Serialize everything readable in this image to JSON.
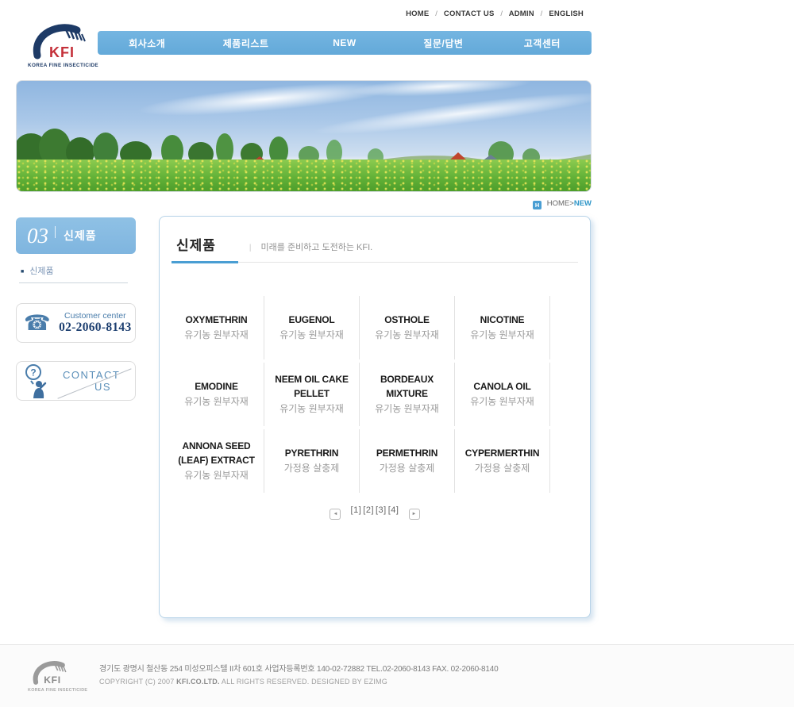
{
  "util_nav": {
    "items": [
      "HOME",
      "CONTACT US",
      "ADMIN",
      "ENGLISH"
    ],
    "separator": "/"
  },
  "logo": {
    "text": "KFI",
    "caption": "KOREA FINE INSECTICIDE"
  },
  "nav": {
    "items": [
      "회사소개",
      "제품리스트",
      "NEW",
      "질문/답변",
      "고객센터"
    ]
  },
  "breadcrumb": {
    "home_icon": "H",
    "home": "HOME",
    "separator": ">",
    "current": "NEW"
  },
  "sidebar": {
    "section_number": "03",
    "section_title": "신제품",
    "menu_bullet": "■",
    "menu_item": "신제품",
    "customer_center": {
      "phone_icon": "☎",
      "label": "Customer center",
      "phone": "02-2060-8143"
    },
    "contact": {
      "line1": "CONTACT",
      "line2": "US"
    }
  },
  "main": {
    "title": "신제품",
    "subtitle_separator": "|",
    "subtitle": "미래를 준비하고 도전하는 KFI.",
    "products": [
      {
        "name": "OXYMETHRIN",
        "category": "유기농 원부자재"
      },
      {
        "name": "EUGENOL",
        "category": "유기농 원부자재"
      },
      {
        "name": "OSTHOLE",
        "category": "유기농 원부자재"
      },
      {
        "name": "NICOTINE",
        "category": "유기농 원부자재"
      },
      {
        "name": "EMODINE",
        "category": "유기농 원부자재"
      },
      {
        "name": "NEEM OIL CAKE PELLET",
        "category": "유기농 원부자재"
      },
      {
        "name": "BORDEAUX MIXTURE",
        "category": "유기농 원부자재"
      },
      {
        "name": "CANOLA OIL",
        "category": "유기농 원부자재"
      },
      {
        "name": "ANNONA SEED (LEAF) EXTRACT",
        "category": "유기농 원부자재"
      },
      {
        "name": "PYRETHRIN",
        "category": "가정용 살충제"
      },
      {
        "name": "PERMETHRIN",
        "category": "가정용 살충제"
      },
      {
        "name": "CYPERMERTHIN",
        "category": "가정용 살충제"
      }
    ],
    "pagination": {
      "prev_icon": "◄",
      "next_icon": "►",
      "pages": [
        "[1]",
        "[2]",
        "[3]",
        "[4]"
      ]
    }
  },
  "footer": {
    "logo_text": "KFI",
    "logo_caption": "KOREA FINE INSECTICIDE",
    "address": "경기도 광명시 철산동 254 미성오피스텔 II차 601호   사업자등록번호 140-02-72882   TEL.02-2060-8143 FAX. 02-2060-8140",
    "copyright_prefix": "COPYRIGHT (C) 2007 ",
    "copyright_company": "KFI.CO.LTD.",
    "copyright_suffix": "  ALL RIGHTS RESERVED. DESIGNED BY EZIMG"
  },
  "colors": {
    "nav_blue": "#6bafdd",
    "sidebar_box_blue": "#87bce2",
    "title_underline": "#4a9ed3",
    "link_blue": "#2f96c8",
    "phone_navy": "#1d3f70",
    "logo_red": "#c43039",
    "logo_navy": "#1d3a66",
    "icon_blue": "#4a7dab"
  }
}
